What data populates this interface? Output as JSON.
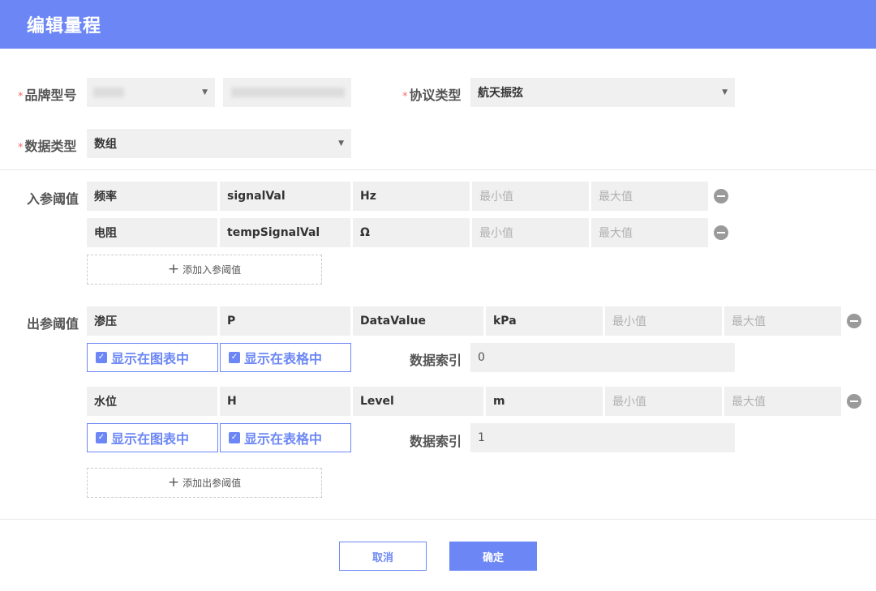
{
  "dialog": {
    "title": "编辑量程"
  },
  "form": {
    "brand_label": "品牌型号",
    "protocol_label": "协议类型",
    "protocol_value": "航天振弦",
    "datatype_label": "数据类型",
    "datatype_value": "数组",
    "required_mark": "*"
  },
  "input_params": {
    "label": "入参阈值",
    "rows": [
      {
        "name": "频率",
        "field": "signalVal",
        "unit": "Hz",
        "min_placeholder": "最小值",
        "max_placeholder": "最大值"
      },
      {
        "name": "电阻",
        "field": "tempSignalVal",
        "unit": "Ω",
        "min_placeholder": "最小值",
        "max_placeholder": "最大值"
      }
    ],
    "add_label": "添加入参阈值"
  },
  "output_params": {
    "label": "出参阈值",
    "rows": [
      {
        "name": "渗压",
        "code": "P",
        "field": "DataValue",
        "unit": "kPa",
        "min_placeholder": "最小值",
        "max_placeholder": "最大值",
        "show_chart": "显示在图表中",
        "show_table": "显示在表格中",
        "index_label": "数据索引",
        "index_value": "0"
      },
      {
        "name": "水位",
        "code": "H",
        "field": "Level",
        "unit": "m",
        "min_placeholder": "最小值",
        "max_placeholder": "最大值",
        "show_chart": "显示在图表中",
        "show_table": "显示在表格中",
        "index_label": "数据索引",
        "index_value": "1"
      }
    ],
    "add_label": "添加出参阈值"
  },
  "footer": {
    "cancel_label": "取消",
    "ok_label": "确定"
  },
  "colors": {
    "accent": "#6c87f5",
    "required": "#f56c6c"
  }
}
